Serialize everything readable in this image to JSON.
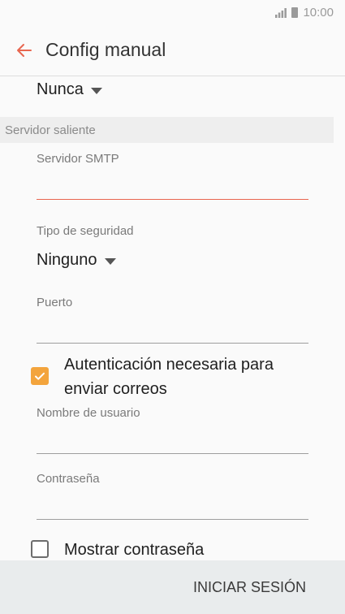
{
  "status_bar": {
    "time": "10:00",
    "signal_icon": "signal-icon",
    "battery_icon": "battery-icon"
  },
  "app_bar": {
    "back_icon": "back-arrow-icon",
    "title": "Config manual",
    "accent_color": "#e8664f"
  },
  "sync_frequency": {
    "value": "Nunca"
  },
  "outgoing_server": {
    "section_title": "Servidor saliente",
    "smtp_server": {
      "label": "Servidor SMTP",
      "value": ""
    },
    "security_type": {
      "label": "Tipo de seguridad",
      "value": "Ninguno"
    },
    "port": {
      "label": "Puerto",
      "value": ""
    },
    "auth_required": {
      "label": "Autenticación necesaria para enviar correos",
      "checked": true,
      "color": "#f3a43c"
    },
    "username": {
      "label": "Nombre de usuario",
      "value": ""
    },
    "password": {
      "label": "Contraseña",
      "value": ""
    },
    "show_password": {
      "label": "Mostrar contraseña",
      "checked": false
    }
  },
  "footer": {
    "login_label": "INICIAR SESIÓN"
  }
}
